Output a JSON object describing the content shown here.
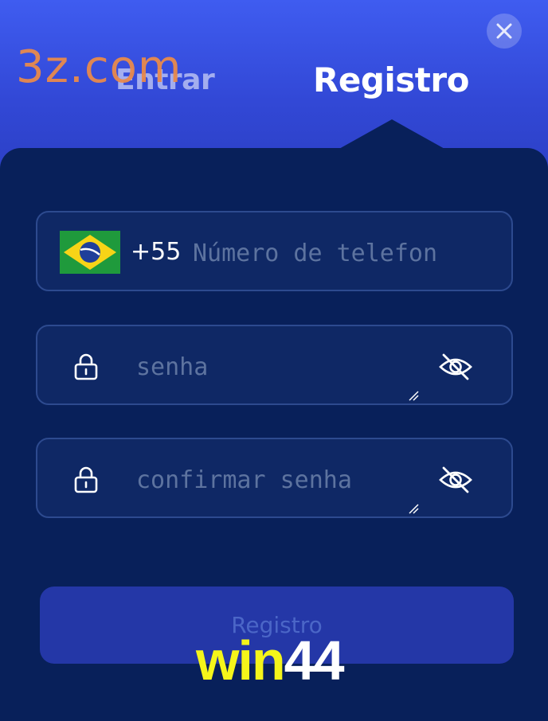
{
  "header": {
    "tabs": [
      {
        "label": "Entrar",
        "active": false
      },
      {
        "label": "Registro",
        "active": true
      }
    ],
    "close_icon": "close-icon"
  },
  "form": {
    "phone": {
      "country_flag": "brazil-flag-icon",
      "dial_code": "+55",
      "placeholder": "Número de telefon"
    },
    "password": {
      "placeholder": "senha",
      "leading_icon": "lock-icon",
      "trailing_icon": "eye-off-icon"
    },
    "confirm_password": {
      "placeholder": "confirmar senha",
      "leading_icon": "lock-icon",
      "trailing_icon": "eye-off-icon"
    },
    "submit_label": "Registro"
  },
  "watermarks": {
    "top": "3z.com",
    "bottom_part1": "win",
    "bottom_part2": "44"
  },
  "colors": {
    "header_gradient_top": "#3f5cf0",
    "panel": "#08205a",
    "field_bg": "#0f2865",
    "field_border": "#2d4a8f",
    "button": "#2437a7",
    "placeholder": "#5d739f",
    "watermark_orange": "#e98a4c",
    "watermark_yellow": "#f5f51a"
  }
}
